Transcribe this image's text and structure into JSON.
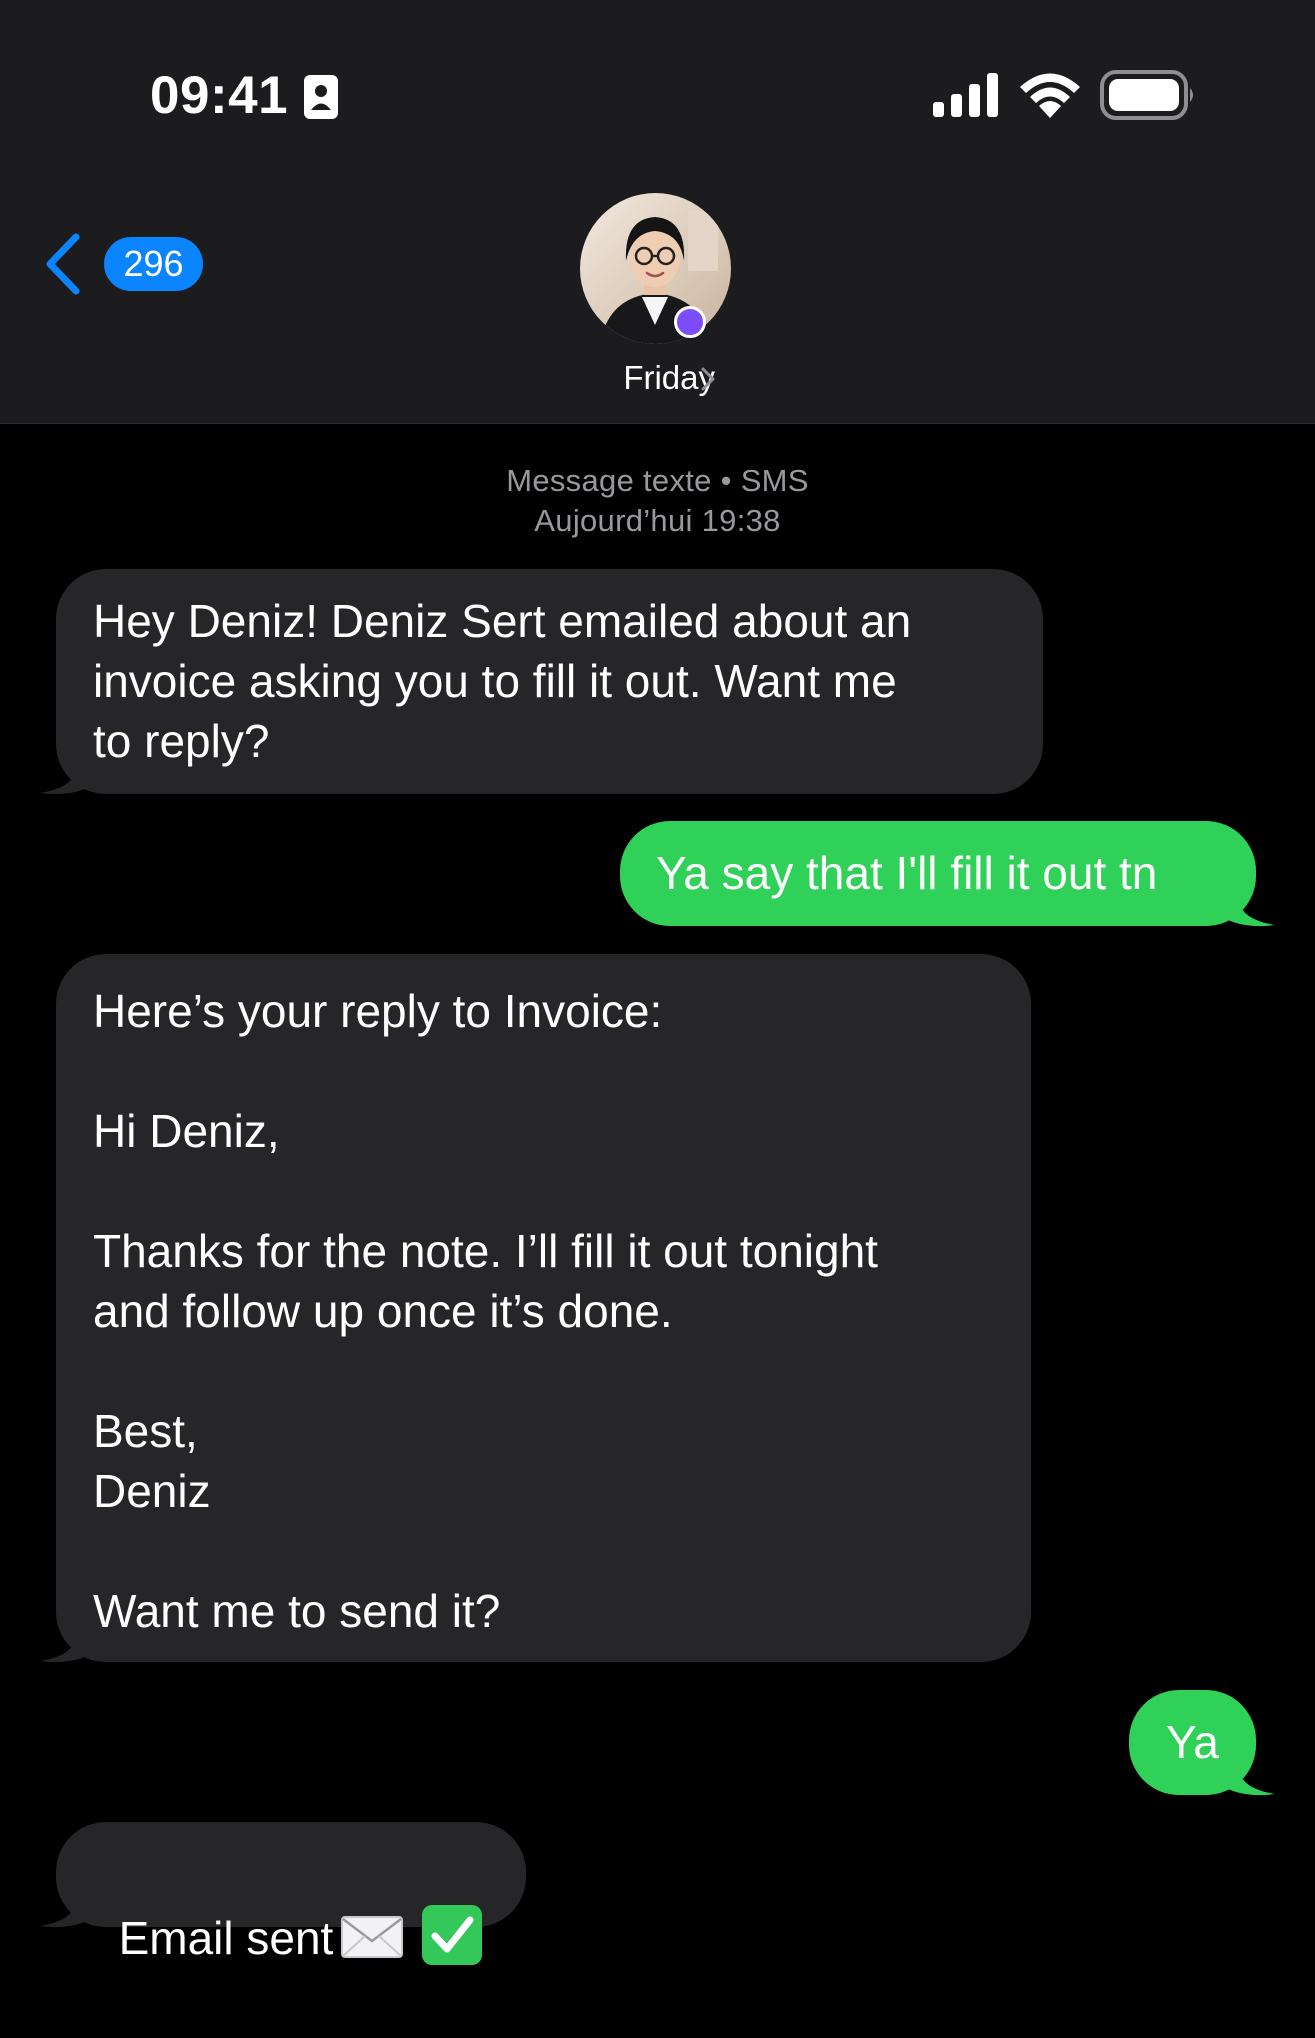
{
  "status_bar": {
    "time": "09:41",
    "icons": [
      "id-card-icon",
      "signal-icon",
      "wifi-icon",
      "battery-icon"
    ]
  },
  "nav": {
    "back_icon": "chevron-left-icon",
    "unread_count": "296",
    "contact_name": "Friday",
    "contact_chevron_icon": "chevron-right-icon"
  },
  "thread": {
    "service_line": "Message texte • SMS",
    "timestamp_line": "Aujourd’hui 19:38",
    "messages": [
      {
        "direction": "incoming",
        "text": "Hey Deniz! Deniz Sert emailed about an\ninvoice asking you to fill it out. Want me\nto reply?"
      },
      {
        "direction": "outgoing",
        "text": "Ya say that I'll fill it out tn"
      },
      {
        "direction": "incoming",
        "text": "Here’s your reply to Invoice:\n\nHi Deniz,\n\nThanks for the note. I’ll fill it out tonight\nand follow up once it’s done.\n\nBest,\nDeniz\n\nWant me to send it?"
      },
      {
        "direction": "outgoing",
        "text": "Ya"
      },
      {
        "direction": "incoming",
        "text": "Email sent",
        "emoji": [
          "envelope-icon",
          "check-mark-icon"
        ]
      }
    ]
  },
  "colors": {
    "background": "#000000",
    "header": "#1c1c1e",
    "incoming_bubble": "#262628",
    "outgoing_bubble": "#30d158",
    "accent": "#0a84ff",
    "meta_text": "#98989d"
  }
}
